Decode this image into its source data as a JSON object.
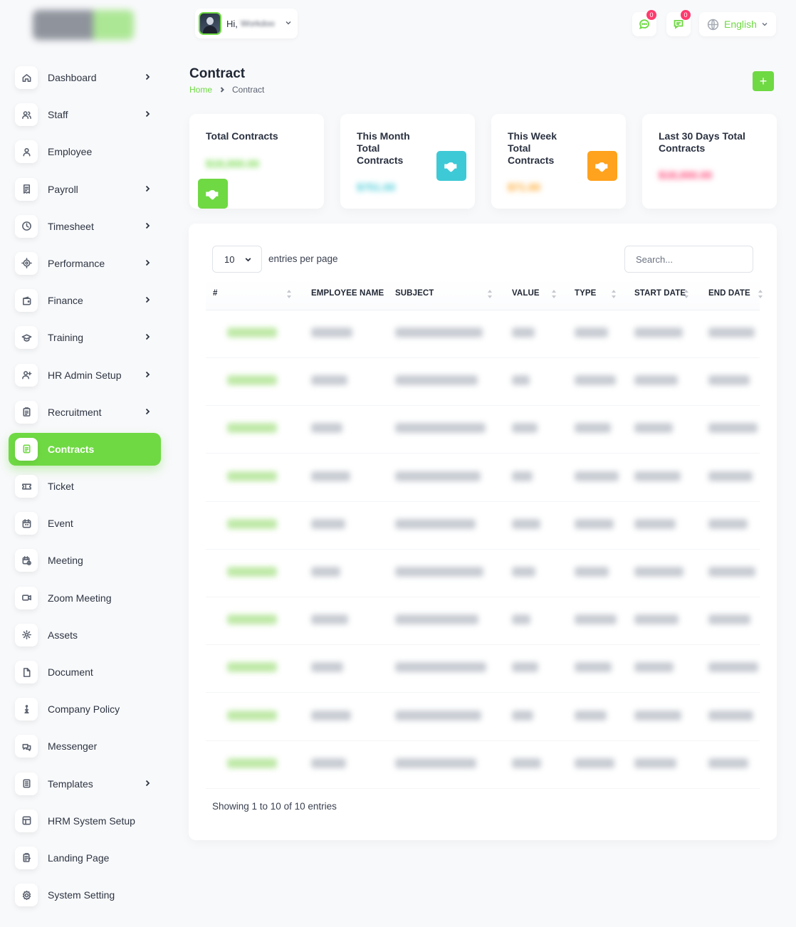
{
  "header": {
    "greeting": "Hi,",
    "user_name": "Workdoo",
    "notification_count": "0",
    "message_count": "0",
    "language": "English"
  },
  "sidebar": {
    "items": [
      {
        "label": "Dashboard",
        "icon": "home-icon",
        "has_children": true,
        "active": false
      },
      {
        "label": "Staff",
        "icon": "users-icon",
        "has_children": true,
        "active": false
      },
      {
        "label": "Employee",
        "icon": "user-icon",
        "has_children": false,
        "active": false
      },
      {
        "label": "Payroll",
        "icon": "receipt-icon",
        "has_children": true,
        "active": false
      },
      {
        "label": "Timesheet",
        "icon": "clock-icon",
        "has_children": true,
        "active": false
      },
      {
        "label": "Performance",
        "icon": "target-icon",
        "has_children": true,
        "active": false
      },
      {
        "label": "Finance",
        "icon": "wallet-icon",
        "has_children": true,
        "active": false
      },
      {
        "label": "Training",
        "icon": "graduation-cap-icon",
        "has_children": true,
        "active": false
      },
      {
        "label": "HR Admin Setup",
        "icon": "user-plus-icon",
        "has_children": true,
        "active": false
      },
      {
        "label": "Recruitment",
        "icon": "clipboard-icon",
        "has_children": true,
        "active": false
      },
      {
        "label": "Contracts",
        "icon": "contract-icon",
        "has_children": false,
        "active": true
      },
      {
        "label": "Ticket",
        "icon": "ticket-icon",
        "has_children": false,
        "active": false
      },
      {
        "label": "Event",
        "icon": "calendar-icon",
        "has_children": false,
        "active": false
      },
      {
        "label": "Meeting",
        "icon": "calendar-time-icon",
        "has_children": false,
        "active": false
      },
      {
        "label": "Zoom Meeting",
        "icon": "video-icon",
        "has_children": false,
        "active": false
      },
      {
        "label": "Assets",
        "icon": "gear-asset-icon",
        "has_children": false,
        "active": false
      },
      {
        "label": "Document",
        "icon": "file-icon",
        "has_children": false,
        "active": false
      },
      {
        "label": "Company Policy",
        "icon": "policy-icon",
        "has_children": false,
        "active": false
      },
      {
        "label": "Messenger",
        "icon": "messages-icon",
        "has_children": false,
        "active": false
      },
      {
        "label": "Templates",
        "icon": "template-icon",
        "has_children": true,
        "active": false
      },
      {
        "label": "HRM System Setup",
        "icon": "table-icon",
        "has_children": false,
        "active": false
      },
      {
        "label": "Landing Page",
        "icon": "page-icon",
        "has_children": false,
        "active": false
      },
      {
        "label": "System Setting",
        "icon": "settings-icon",
        "has_children": false,
        "active": false
      }
    ]
  },
  "page": {
    "title": "Contract",
    "breadcrumb_home": "Home",
    "breadcrumb_current": "Contract",
    "add_label": "+"
  },
  "stats": [
    {
      "title": "Total Contracts",
      "value": "$18,000.00",
      "color": "#6fd943"
    },
    {
      "title": "This Month Total Contracts",
      "value": "$751.00",
      "color": "#3ec9d6"
    },
    {
      "title": "This Week Total Contracts",
      "value": "$71.00",
      "color": "#ffa21d"
    },
    {
      "title": "Last 30 Days Total Contracts",
      "value": "$18,000.00",
      "color": "#ff3a6e"
    }
  ],
  "table": {
    "per_page": "10",
    "entries_per_page_label": "entries per page",
    "search_placeholder": "Search...",
    "columns": [
      "#",
      "EMPLOYEE NAME",
      "SUBJECT",
      "VALUE",
      "TYPE",
      "START DATE",
      "END DATE"
    ],
    "showing": "Showing 1 to 10 of 10 entries"
  },
  "colors": {
    "accent": "#6fd943",
    "badge": "#ff3a6e",
    "text": "#293240"
  }
}
